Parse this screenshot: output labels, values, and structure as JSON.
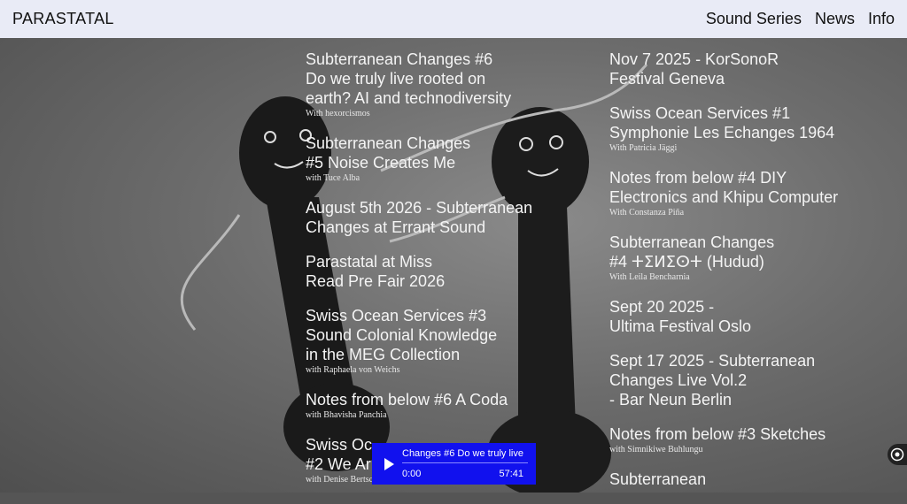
{
  "header": {
    "logo": "PARASTATAL",
    "nav": [
      "Sound Series",
      "News",
      "Info"
    ]
  },
  "left_column": [
    {
      "title": "Subterranean Changes #6\nDo we truly live rooted on\nearth? AI and technodiversity",
      "by": "With hexorcismos"
    },
    {
      "title": "Subterranean Changes\n#5 Noise Creates Me",
      "by": "with Tuce Alba"
    },
    {
      "title": "August 5th 2026 - Subterranean\nChanges at Errant Sound",
      "by": ""
    },
    {
      "title": "Parastatal at Miss\nRead Pre Fair 2026",
      "by": ""
    },
    {
      "title": "Swiss Ocean Services #3\nSound Colonial Knowledge\nin the MEG Collection",
      "by": "with Raphaela von Weichs"
    },
    {
      "title": "Notes from below #6 A Coda",
      "by": "with Bhavisha Panchia"
    },
    {
      "title": "Swiss Oc\n#2 We Ar",
      "by": "with Denise Bertschi"
    }
  ],
  "right_column": [
    {
      "title": "Nov 7 2025 - KorSonoR\nFestival Geneva",
      "by": ""
    },
    {
      "title": "Swiss Ocean Services #1\nSymphonie Les Echanges 1964",
      "by": "With Patricia Jäggi"
    },
    {
      "title": "Notes from below #4 DIY\nElectronics and Khipu Computer",
      "by": "With Constanza Piña"
    },
    {
      "title": "Subterranean Changes\n#4 ⵜⵉⵍⵉⵙⵜ (Hudud)",
      "by": "With Leila Bencharnia"
    },
    {
      "title": "Sept 20 2025 -\nUltima Festival Oslo",
      "by": ""
    },
    {
      "title": "Sept 17 2025 - Subterranean\nChanges Live Vol.2\n- Bar Neun Berlin",
      "by": ""
    },
    {
      "title": "Notes from below #3 Sketches",
      "by": "with Simnikiwe Buhlungu"
    },
    {
      "title": "Subterranean",
      "by": ""
    }
  ],
  "player": {
    "title": "Changes #6 Do we truly live",
    "current_time": "0:00",
    "duration": "57:41",
    "progress": 0
  },
  "icons": {
    "play": "play-icon",
    "accessibility": "accessibility-icon"
  },
  "colors": {
    "header_bg": "#e9ebf6",
    "player_bg": "#1111ee"
  }
}
